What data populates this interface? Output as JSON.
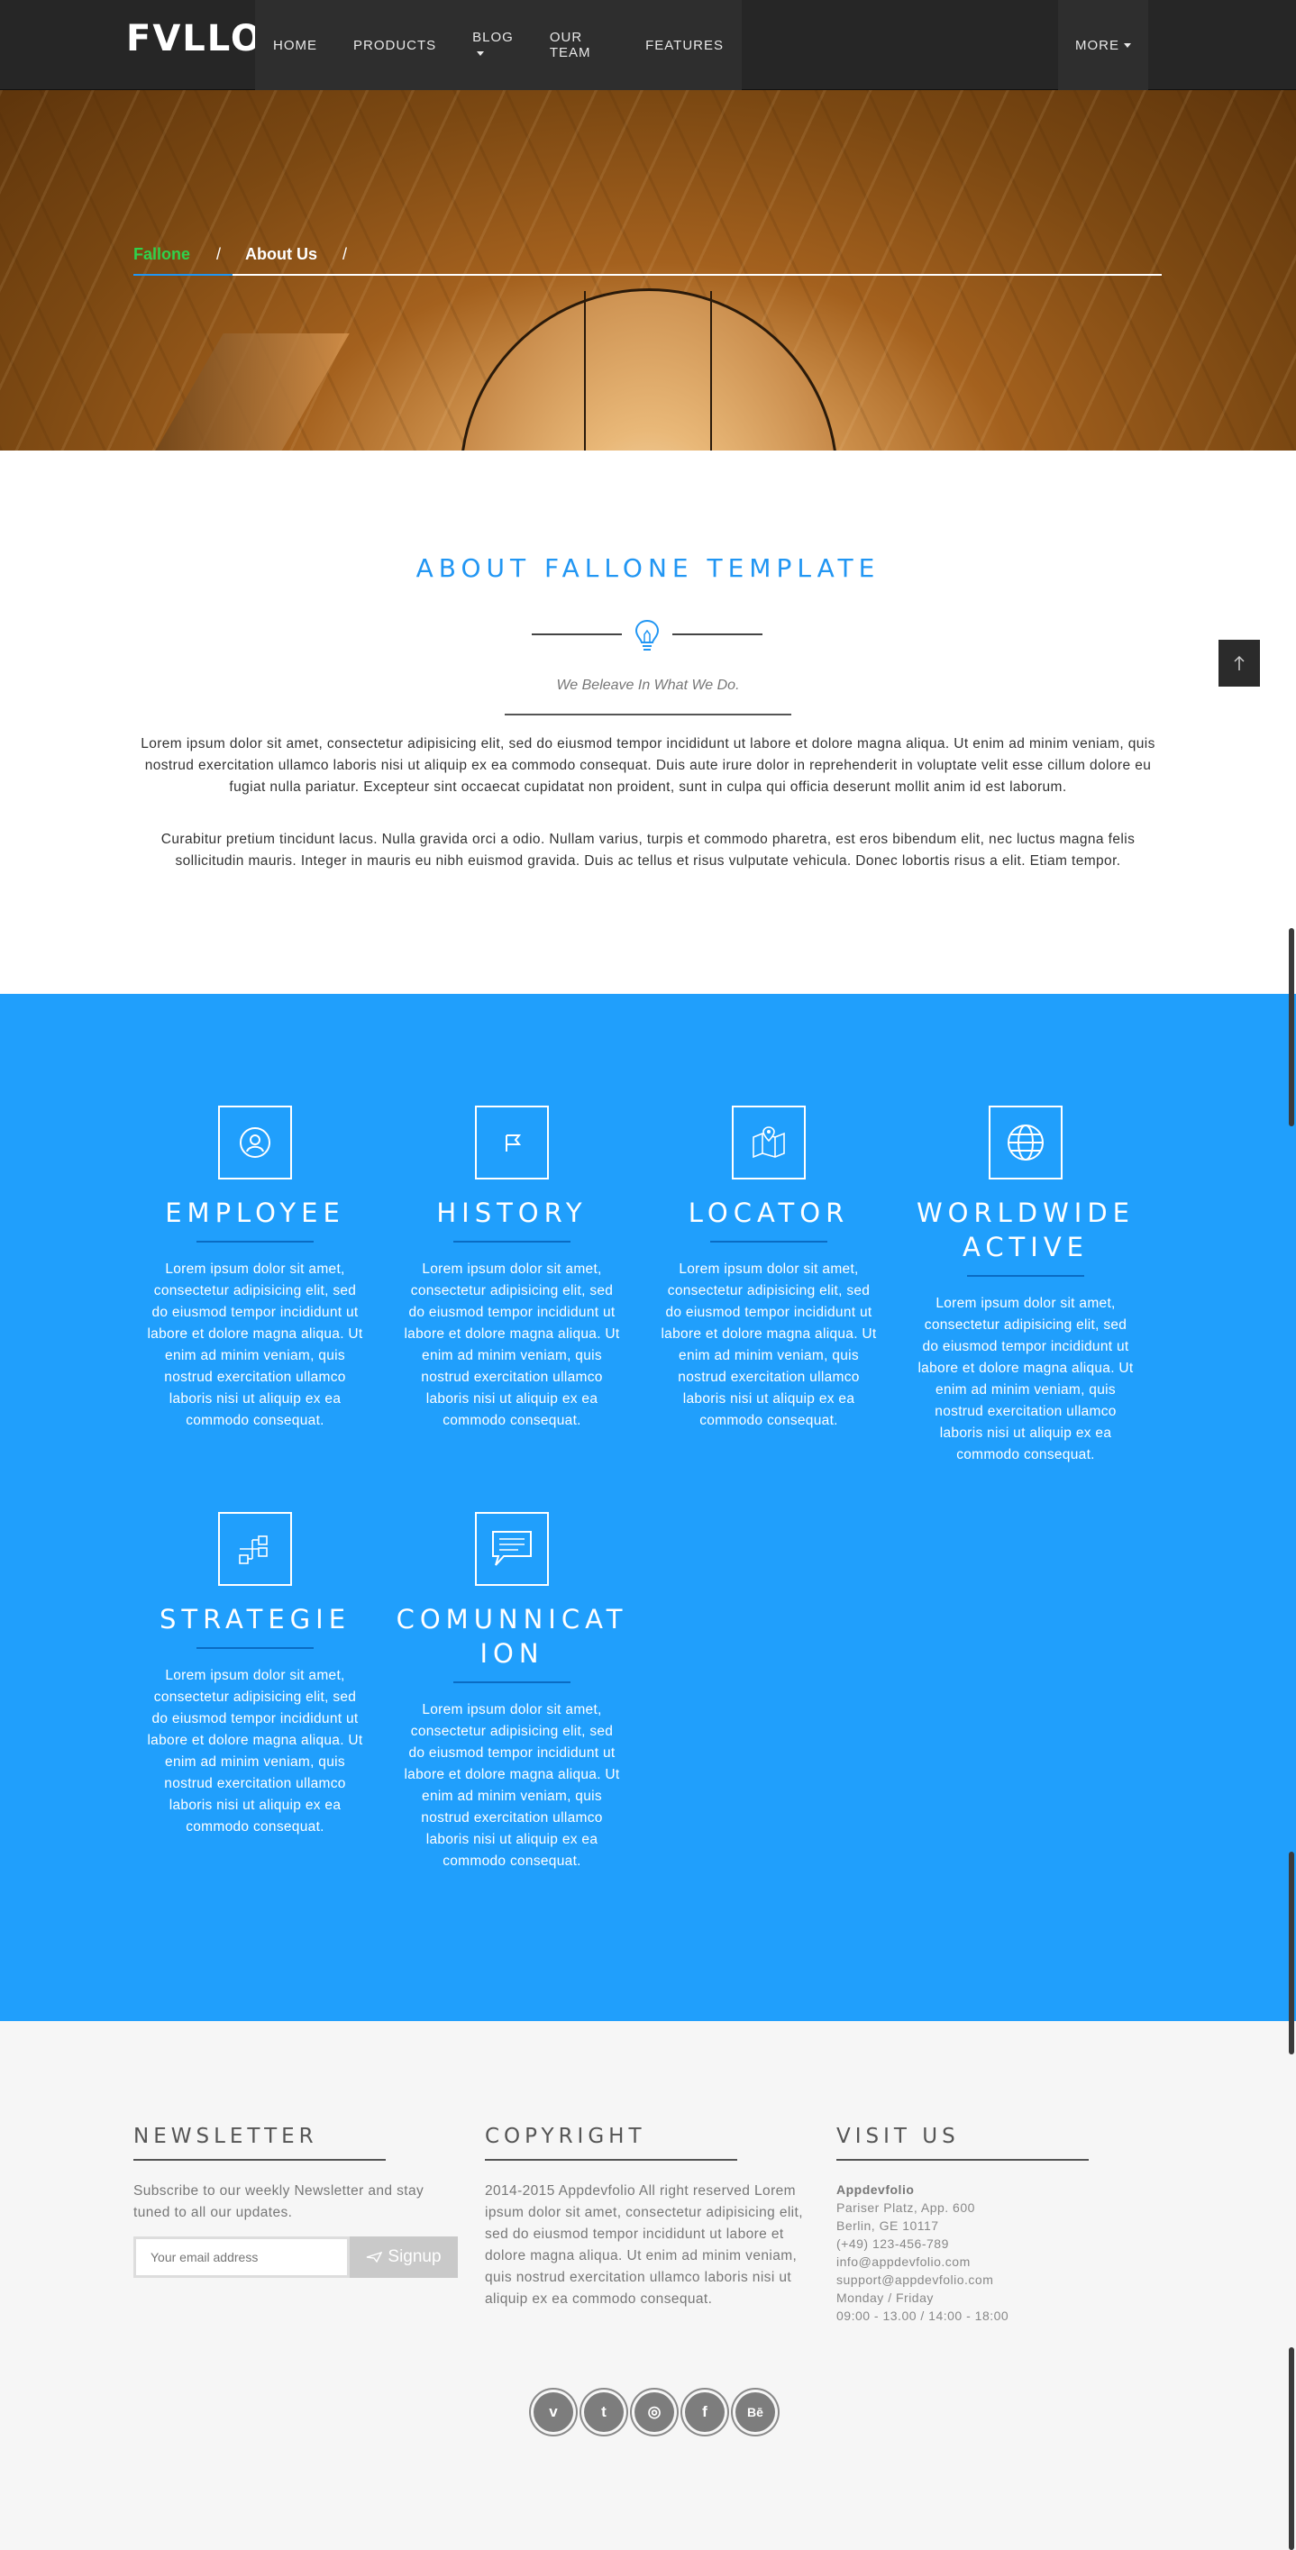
{
  "nav": {
    "logo": "FVLLONE",
    "items": [
      "HOME",
      "PRODUCTS",
      "BLOG",
      "OUR TEAM",
      "FEATURES"
    ],
    "more": "MORE"
  },
  "breadcrumb": {
    "home": "Fallone",
    "current": "About Us",
    "separator": "/"
  },
  "about": {
    "title": "ABOUT FALLONE TEMPLATE",
    "subtitle": "We Beleave In What We Do.",
    "paragraphs": [
      "Lorem ipsum dolor sit amet, consectetur adipisicing elit, sed do eiusmod tempor incididunt ut labore et dolore magna aliqua. Ut enim ad minim veniam, quis nostrud exercitation ullamco laboris nisi ut aliquip ex ea commodo consequat. Duis aute irure dolor in reprehenderit in voluptate velit esse cillum dolore eu fugiat nulla pariatur. Excepteur sint occaecat cupidatat non proident, sunt in culpa qui officia deserunt mollit anim id est laborum.",
      "Curabitur pretium tincidunt lacus. Nulla gravida orci a odio. Nullam varius, turpis et commodo pharetra, est eros bibendum elit, nec luctus magna felis sollicitudin mauris. Integer in mauris eu nibh euismod gravida. Duis ac tellus et risus vulputate vehicula. Donec lobortis risus a elit. Etiam tempor."
    ]
  },
  "features": [
    {
      "title": "EMPLOYEE",
      "icon": "user-circle-icon",
      "text": "Lorem ipsum dolor sit amet, consectetur adipisicing elit, sed do eiusmod tempor incididunt ut labore et dolore magna aliqua. Ut enim ad minim veniam, quis nostrud exercitation ullamco laboris nisi ut aliquip ex ea commodo consequat."
    },
    {
      "title": "HISTORY",
      "icon": "flag-icon",
      "text": "Lorem ipsum dolor sit amet, consectetur adipisicing elit, sed do eiusmod tempor incididunt ut labore et dolore magna aliqua. Ut enim ad minim veniam, quis nostrud exercitation ullamco laboris nisi ut aliquip ex ea commodo consequat."
    },
    {
      "title": "LOCATOR",
      "icon": "map-pin-icon",
      "text": "Lorem ipsum dolor sit amet, consectetur adipisicing elit, sed do eiusmod tempor incididunt ut labore et dolore magna aliqua. Ut enim ad minim veniam, quis nostrud exercitation ullamco laboris nisi ut aliquip ex ea commodo consequat."
    },
    {
      "title": "WORLDWIDE ACTIVE",
      "icon": "globe-icon",
      "text": "Lorem ipsum dolor sit amet, consectetur adipisicing elit, sed do eiusmod tempor incididunt ut labore et dolore magna aliqua. Ut enim ad minim veniam, quis nostrud exercitation ullamco laboris nisi ut aliquip ex ea commodo consequat."
    },
    {
      "title": "STRATEGIE",
      "icon": "flowchart-icon",
      "text": "Lorem ipsum dolor sit amet, consectetur adipisicing elit, sed do eiusmod tempor incididunt ut labore et dolore magna aliqua. Ut enim ad minim veniam, quis nostrud exercitation ullamco laboris nisi ut aliquip ex ea commodo consequat."
    },
    {
      "title": "COMUNNICATION",
      "icon": "chat-icon",
      "text": "Lorem ipsum dolor sit amet, consectetur adipisicing elit, sed do eiusmod tempor incididunt ut labore et dolore magna aliqua. Ut enim ad minim veniam, quis nostrud exercitation ullamco laboris nisi ut aliquip ex ea commodo consequat."
    }
  ],
  "footer": {
    "newsletter": {
      "title": "NEWSLETTER",
      "text": "Subscribe to our weekly Newsletter and stay tuned to all our updates.",
      "placeholder": "Your email address",
      "button": "Signup"
    },
    "copyright": {
      "title": "COPYRIGHT",
      "text": "2014-2015 Appdevfolio All right reserved Lorem ipsum dolor sit amet, consectetur adipisicing elit, sed do eiusmod tempor incididunt ut labore et dolore magna aliqua. Ut enim ad minim veniam, quis nostrud exercitation ullamco laboris nisi ut aliquip ex ea commodo consequat."
    },
    "visit": {
      "title": "VISIT US",
      "lines": [
        "Appdevfolio",
        "Pariser Platz, App. 600",
        "Berlin, GE 10117",
        "(+49) 123-456-789",
        "info@appdevfolio.com",
        "support@appdevfolio.com",
        "Monday / Friday",
        "09:00 - 13.00 / 14:00 - 18:00"
      ]
    },
    "socials": [
      {
        "name": "vimeo-icon",
        "glyph": "v"
      },
      {
        "name": "twitter-icon",
        "glyph": "t"
      },
      {
        "name": "instagram-icon",
        "glyph": "◎"
      },
      {
        "name": "facebook-icon",
        "glyph": "f"
      },
      {
        "name": "behance-icon",
        "glyph": "Bē"
      }
    ]
  },
  "colors": {
    "accent": "#209ffc",
    "breadcrumb_active": "#2fd24c",
    "nav_bg": "#262626"
  }
}
